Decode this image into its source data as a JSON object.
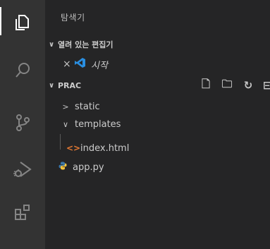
{
  "activity_bar": {
    "icons": [
      "explorer-icon",
      "search-icon",
      "source-control-icon",
      "run-debug-icon",
      "extensions-icon"
    ]
  },
  "sidebar": {
    "title": "탐색기",
    "open_editors": {
      "header": "열려 있는 편집기",
      "items": [
        {
          "close": "×",
          "label": "시작"
        }
      ]
    },
    "workspace": {
      "header": "PRAC",
      "actions": [
        "new-file-icon",
        "new-folder-icon",
        "refresh-icon",
        "collapse-icon"
      ],
      "tree": [
        {
          "chevron": ">",
          "label": "static"
        },
        {
          "chevron": "∨",
          "label": "templates"
        },
        {
          "icon": "<>",
          "label": "index.html"
        },
        {
          "label": "app.py"
        }
      ]
    }
  }
}
